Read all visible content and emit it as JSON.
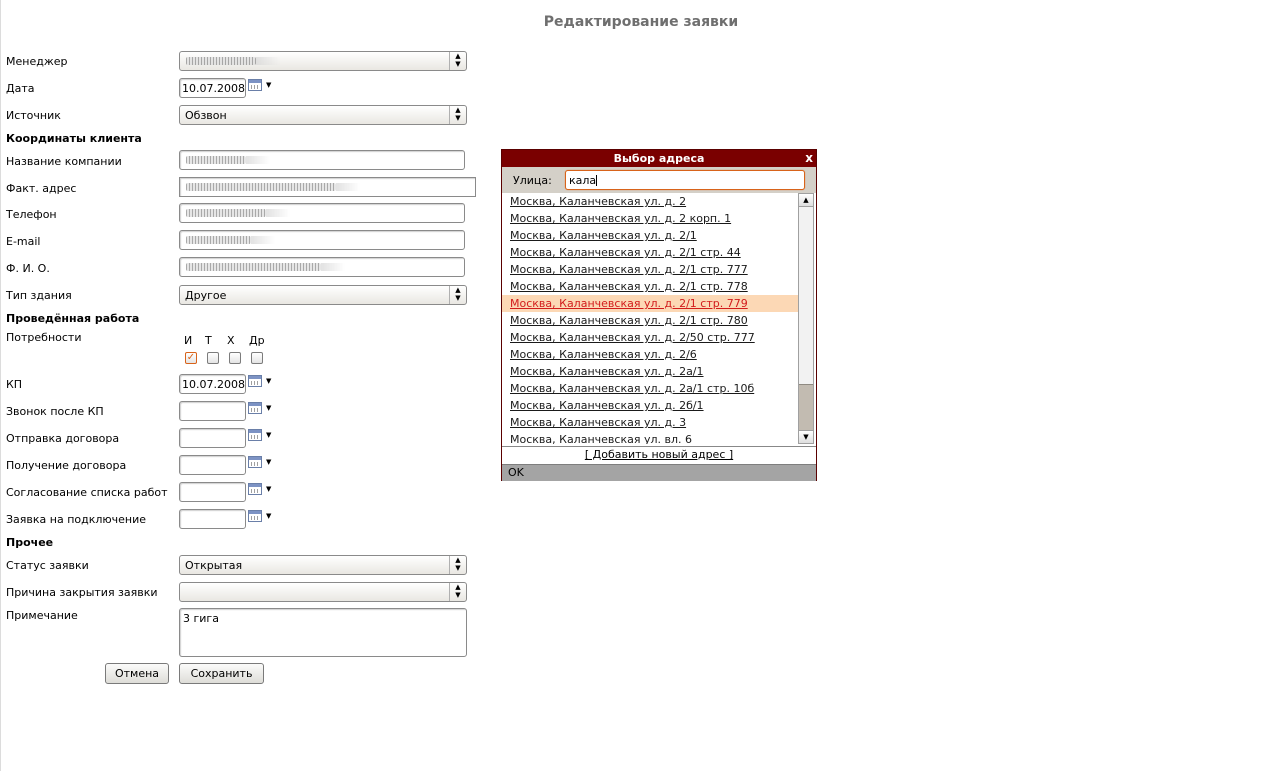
{
  "page_title": "Редактирование заявки",
  "form": {
    "manager_label": "Менеджер",
    "date_label": "Дата",
    "date_value": "10.07.2008",
    "source_label": "Источник",
    "source_value": "Обзвон",
    "section_client": "Координаты клиента",
    "company_label": "Название компании",
    "address_label": "Факт. адрес",
    "phone_label": "Телефон",
    "email_label": "E-mail",
    "fio_label": "Ф. И. О.",
    "building_label": "Тип здания",
    "building_value": "Другое",
    "section_work": "Проведённая работа",
    "needs_label": "Потребности",
    "needs": [
      "И",
      "Т",
      "Х",
      "Др"
    ],
    "needs_checked": [
      true,
      false,
      false,
      false
    ],
    "kp_label": "КП",
    "kp_value": "10.07.2008",
    "call_after_kp_label": "Звонок после КП",
    "contract_sent_label": "Отправка договора",
    "contract_received_label": "Получение договора",
    "works_list_label": "Согласование списка работ",
    "connection_request_label": "Заявка на подключение",
    "section_other": "Прочее",
    "status_label": "Статус заявки",
    "status_value": "Открытая",
    "close_reason_label": "Причина закрытия заявки",
    "close_reason_value": "",
    "note_label": "Примечание",
    "note_value": "3 гига",
    "cancel_label": "Отмена",
    "save_label": "Сохранить"
  },
  "dialog": {
    "title": "Выбор адреса",
    "close_label": "x",
    "street_label": "Улица:",
    "street_value": "кала",
    "highlighted_index": 6,
    "addresses": [
      "Москва, Каланчевская ул. д. 2",
      "Москва, Каланчевская ул. д. 2 корп. 1",
      "Москва, Каланчевская ул. д. 2/1",
      "Москва, Каланчевская ул. д. 2/1 стр. 44",
      "Москва, Каланчевская ул. д. 2/1 стр. 777",
      "Москва, Каланчевская ул. д. 2/1 стр. 778",
      "Москва, Каланчевская ул. д. 2/1 стр. 779",
      "Москва, Каланчевская ул. д. 2/1 стр. 780",
      "Москва, Каланчевская ул. д. 2/50 стр. 777",
      "Москва, Каланчевская ул. д. 2/6",
      "Москва, Каланчевская ул. д. 2а/1",
      "Москва, Каланчевская ул. д. 2а/1 стр. 10б",
      "Москва, Каланчевская ул. д. 2б/1",
      "Москва, Каланчевская ул. д. 3",
      "Москва, Каланчевская ул. вл. 6"
    ],
    "add_label": "[ Добавить новый адрес ]",
    "ok_label": "OK"
  },
  "icons": {
    "calendar": "calendar-icon",
    "select_arrow": "updown-arrow-icon"
  },
  "colors": {
    "dialog_header": "#7a0000",
    "highlight_bg": "#fcd8b5",
    "highlight_text": "#d21c1c",
    "focus_border": "#d8631a"
  }
}
